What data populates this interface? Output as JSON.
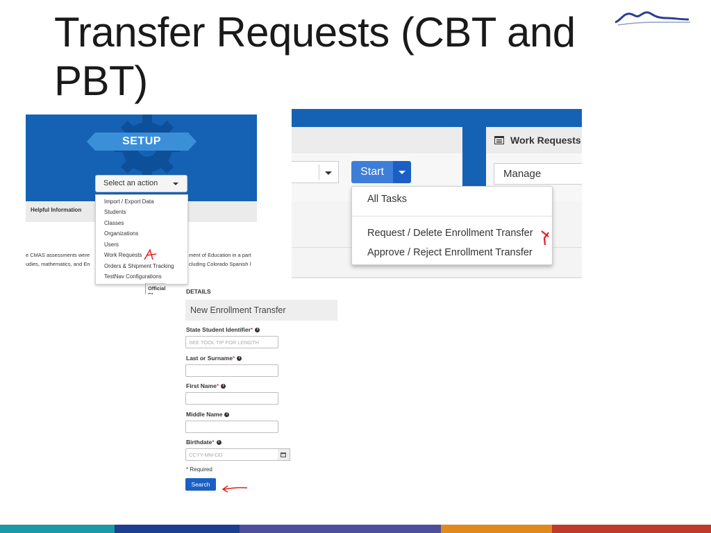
{
  "slide": {
    "title": "Transfer Requests (CBT and PBT)"
  },
  "setup_panel": {
    "banner": "SETUP",
    "select_action": "Select an action",
    "helpful_info": "Helpful Information",
    "menu_items": [
      "Import / Export Data",
      "Students",
      "Classes",
      "Organizations",
      "Users",
      "Work Requests",
      "Orders & Shipment Tracking",
      "TestNav Configurations"
    ],
    "para_left_1": "e CMAS assessments were",
    "para_left_2": "udies, mathematics, and En",
    "para_right_1": "ment of Education in a part",
    "para_right_2": "cluding Colorado Spanish l",
    "official_label": "Official St"
  },
  "task_panel": {
    "start_label": "Start",
    "work_requests_title": "Work Requests",
    "manage_label": "Manage",
    "start_menu": [
      "All Tasks",
      "Request / Delete Enrollment Transfer",
      "Approve / Reject Enrollment Transfer"
    ]
  },
  "form": {
    "details_label": "DETAILS",
    "section_title": "New Enrollment Transfer",
    "fields": [
      {
        "label": "State Student Identifier",
        "required": "*",
        "placeholder": "SEE TOOL TIP FOR LENGTH"
      },
      {
        "label": "Last or Surname",
        "required": "*",
        "placeholder": ""
      },
      {
        "label": "First Name",
        "required": "*",
        "placeholder": ""
      },
      {
        "label": "Middle Name",
        "required": "",
        "placeholder": ""
      },
      {
        "label": "Birthdate",
        "required": "*",
        "placeholder": "CCYY-MM-DD"
      }
    ],
    "required_note": "* Required",
    "search_button": "Search"
  },
  "colors": {
    "primary_blue": "#1562b5",
    "button_blue": "#1b5fc4",
    "annotation_red": "#e02020",
    "bottom_bar": [
      "#1a9aa8",
      "#1c3f8f",
      "#4d4f9c",
      "#e08a1e",
      "#c03a2b"
    ]
  }
}
